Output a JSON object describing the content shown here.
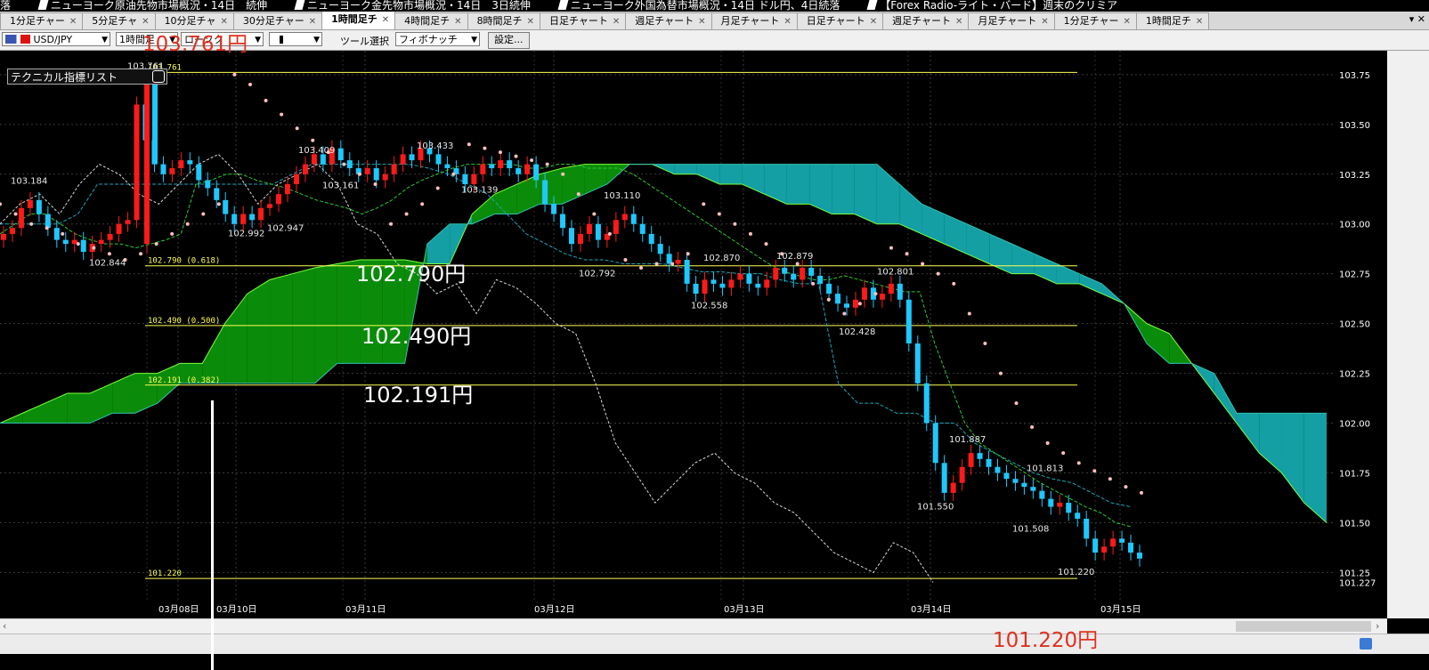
{
  "ticker": [
    "落",
    "ニューヨーク原油先物市場概況・14日　続伸",
    "ニューヨーク金先物市場概況・14日　3日続伸",
    "ニューヨーク外国為替市場概況・14日 ドル円、4日続落",
    "【Forex Radio-ライト・バード】週末のクリミア"
  ],
  "tabs": [
    {
      "label": "1分足チャー",
      "active": false
    },
    {
      "label": "5分足チャ",
      "active": false
    },
    {
      "label": "10分足チャ",
      "active": false
    },
    {
      "label": "30分足チャー",
      "active": false
    },
    {
      "label": "1時間足チ",
      "active": true
    },
    {
      "label": "4時間足チ",
      "active": false
    },
    {
      "label": "8時間足チ",
      "active": false
    },
    {
      "label": "日足チャート",
      "active": false
    },
    {
      "label": "週足チャート",
      "active": false
    },
    {
      "label": "月足チャート",
      "active": false
    },
    {
      "label": "日足チャート",
      "active": false
    },
    {
      "label": "週足チャート",
      "active": false
    },
    {
      "label": "月足チャート",
      "active": false
    },
    {
      "label": "1分足チャー",
      "active": false
    },
    {
      "label": "1時間足チ",
      "active": false
    }
  ],
  "tab_controls": "▾ ✕",
  "toolbar": {
    "pair": "USD/JPY",
    "timeframe": "1時間足",
    "chart_style": "ローソク",
    "tool_label": "ツール選択",
    "tool_value": "フィボナッチ",
    "settings": "設定..."
  },
  "tech_list_label": "テクニカル指標リスト",
  "annotations": {
    "high": "103.761円",
    "fib618": "102.790円",
    "fib500": "102.490円",
    "fib382": "102.191円",
    "low": "101.220円"
  },
  "colors": {
    "up": "#ff1a1a",
    "down": "#1ec8ff",
    "cloud_bull": "#0a8c0a",
    "cloud_bear": "#139fa3",
    "fib": "#ffff55",
    "psar": "#ffc0c0",
    "grid": "#3a3a3a"
  },
  "chart_data": {
    "type": "candlestick",
    "ylim": [
      101.1,
      103.87
    ],
    "y_ticks": [
      103.75,
      103.5,
      103.25,
      103.0,
      102.75,
      102.5,
      102.25,
      102.0,
      101.75,
      101.5,
      101.25
    ],
    "y_tick_labels": [
      "103.75",
      "103.50",
      "103.25",
      "103.00",
      "102.75",
      "102.50",
      "102.25",
      "102.00",
      "101.75",
      "101.50",
      "101.25"
    ],
    "y_edge_label": "101.227",
    "x_dates": [
      "03月08日",
      "03月10日",
      "03月11日",
      "03月12日",
      "03月13日",
      "03月14日",
      "03月15日"
    ],
    "fib_levels": [
      {
        "value": 103.761,
        "label": "103.761"
      },
      {
        "value": 102.79,
        "label": "102.790 (0.618)"
      },
      {
        "value": 102.49,
        "label": "102.490 (0.500)"
      },
      {
        "value": 102.191,
        "label": "102.191 (0.382)"
      },
      {
        "value": 101.22,
        "label": "101.220"
      }
    ],
    "price_labels": [
      {
        "v": 103.184,
        "t": "103.184"
      },
      {
        "v": 102.844,
        "t": "102.844"
      },
      {
        "v": 103.761,
        "t": "103.761"
      },
      {
        "v": 102.992,
        "t": "102.992"
      },
      {
        "v": 102.947,
        "t": "102.947"
      },
      {
        "v": 103.409,
        "t": "103.409"
      },
      {
        "v": 103.161,
        "t": "103.161"
      },
      {
        "v": 103.433,
        "t": "103.433"
      },
      {
        "v": 103.139,
        "t": "103.139"
      },
      {
        "v": 102.792,
        "t": "102.792"
      },
      {
        "v": 103.11,
        "t": "103.110"
      },
      {
        "v": 102.87,
        "t": "102.870"
      },
      {
        "v": 102.558,
        "t": "102.558"
      },
      {
        "v": 102.879,
        "t": "102.879"
      },
      {
        "v": 102.428,
        "t": "102.428"
      },
      {
        "v": 102.801,
        "t": "102.801"
      },
      {
        "v": 101.887,
        "t": "101.887"
      },
      {
        "v": 101.813,
        "t": "101.813"
      },
      {
        "v": 101.55,
        "t": "101.550"
      },
      {
        "v": 101.508,
        "t": "101.508"
      },
      {
        "v": 101.22,
        "t": "101.220"
      }
    ],
    "closes": [
      102.95,
      102.98,
      103.08,
      103.12,
      103.05,
      102.98,
      102.92,
      102.9,
      102.92,
      102.86,
      102.9,
      102.92,
      102.95,
      103.0,
      103.02,
      103.6,
      103.42,
      103.3,
      103.25,
      103.28,
      103.32,
      103.3,
      103.22,
      103.18,
      103.12,
      103.05,
      103.0,
      103.05,
      103.02,
      103.08,
      103.1,
      103.15,
      103.2,
      103.25,
      103.3,
      103.35,
      103.3,
      103.38,
      103.32,
      103.28,
      103.25,
      103.28,
      103.22,
      103.25,
      103.3,
      103.35,
      103.32,
      103.38,
      103.35,
      103.3,
      103.28,
      103.25,
      103.2,
      103.25,
      103.3,
      103.28,
      103.32,
      103.28,
      103.25,
      103.3,
      103.22,
      103.1,
      103.05,
      102.98,
      102.9,
      102.95,
      103.0,
      102.92,
      102.95,
      103.02,
      103.05,
      103.0,
      102.95,
      102.9,
      102.85,
      102.8,
      102.82,
      102.7,
      102.65,
      102.72,
      102.7,
      102.68,
      102.72,
      102.75,
      102.7,
      102.68,
      102.72,
      102.78,
      102.75,
      102.72,
      102.78,
      102.74,
      102.7,
      102.65,
      102.6,
      102.58,
      102.62,
      102.68,
      102.62,
      102.65,
      102.7,
      102.62,
      102.4,
      102.2,
      102.0,
      101.8,
      101.65,
      101.7,
      101.78,
      101.85,
      101.82,
      101.78,
      101.75,
      101.72,
      101.7,
      101.68,
      101.66,
      101.62,
      101.58,
      101.6,
      101.55,
      101.52,
      101.42,
      101.35,
      101.38,
      101.42,
      101.4,
      101.35,
      101.32
    ],
    "tenkan": [
      102.95,
      103.0,
      103.05,
      103.05,
      103.0,
      102.95,
      102.92,
      102.9,
      102.9,
      102.88,
      102.9,
      102.92,
      102.95,
      103.2,
      103.22,
      103.25,
      103.25,
      103.22,
      103.2,
      103.18,
      103.15,
      103.12,
      103.1,
      103.08,
      103.05,
      103.08,
      103.12,
      103.18,
      103.22,
      103.25,
      103.28,
      103.3,
      103.3,
      103.3,
      103.3,
      103.28,
      103.28,
      103.3,
      103.3,
      103.28,
      103.28,
      103.28,
      103.25,
      103.2,
      103.15,
      103.1,
      103.05,
      103.0,
      102.95,
      102.9,
      102.85,
      102.8,
      102.76,
      102.74,
      102.72,
      102.72,
      102.74,
      102.72,
      102.7,
      102.68,
      102.66,
      102.66,
      102.4,
      102.2,
      102.0,
      101.9,
      101.85,
      101.8,
      101.75,
      101.7,
      101.66,
      101.62,
      101.58,
      101.55,
      101.5,
      101.48
    ],
    "kijun": [
      103.0,
      103.0,
      103.0,
      103.0,
      103.05,
      103.2,
      103.2,
      103.2,
      103.2,
      103.2,
      103.2,
      103.2,
      103.2,
      103.2,
      103.2,
      103.25,
      103.3,
      103.3,
      103.3,
      103.3,
      103.3,
      103.3,
      103.28,
      103.25,
      103.2,
      103.15,
      103.05,
      102.95,
      102.9,
      102.85,
      102.82,
      102.82,
      102.8,
      102.8,
      102.8,
      102.78,
      102.76,
      102.76,
      102.75,
      102.75,
      102.72,
      102.7,
      102.7,
      102.2,
      102.1,
      102.1,
      102.05,
      102.05,
      102.0,
      102.0,
      101.9,
      101.85,
      101.8,
      101.75,
      101.72,
      101.7,
      101.65,
      101.6,
      101.58
    ],
    "chikou": [
      103.0,
      103.1,
      103.15,
      103.05,
      103.2,
      103.3,
      103.25,
      103.15,
      103.1,
      103.2,
      103.3,
      103.35,
      103.25,
      103.1,
      103.2,
      103.25,
      103.3,
      103.2,
      103.0,
      102.95,
      102.8,
      102.75,
      102.65,
      102.7,
      102.55,
      102.72,
      102.68,
      102.6,
      102.5,
      102.45,
      102.2,
      101.9,
      101.75,
      101.6,
      101.7,
      101.8,
      101.85,
      101.75,
      101.7,
      101.6,
      101.55,
      101.45,
      101.35,
      101.3,
      101.25,
      101.4,
      101.35,
      101.2
    ],
    "span_a": [
      102.0,
      102.05,
      102.1,
      102.15,
      102.15,
      102.2,
      102.25,
      102.25,
      102.3,
      102.3,
      102.5,
      102.65,
      102.72,
      102.75,
      102.78,
      102.8,
      102.82,
      102.82,
      102.82,
      102.8,
      102.8,
      103.05,
      103.15,
      103.2,
      103.25,
      103.28,
      103.3,
      103.3,
      103.3,
      103.3,
      103.25,
      103.25,
      103.2,
      103.2,
      103.15,
      103.1,
      103.1,
      103.05,
      103.05,
      103.0,
      103.0,
      102.95,
      102.9,
      102.85,
      102.8,
      102.75,
      102.75,
      102.7,
      102.7,
      102.65,
      102.6,
      102.5,
      102.45,
      102.3,
      102.15,
      102.0,
      101.85,
      101.75,
      101.6,
      101.5
    ],
    "span_b": [
      102.0,
      102.0,
      102.0,
      102.0,
      102.0,
      102.05,
      102.05,
      102.1,
      102.2,
      102.2,
      102.2,
      102.2,
      102.2,
      102.2,
      102.2,
      102.3,
      102.3,
      102.3,
      102.3,
      102.9,
      103.0,
      103.0,
      103.05,
      103.05,
      103.1,
      103.1,
      103.15,
      103.2,
      103.3,
      103.3,
      103.3,
      103.3,
      103.3,
      103.3,
      103.3,
      103.3,
      103.3,
      103.3,
      103.3,
      103.3,
      103.2,
      103.1,
      103.05,
      103.0,
      102.95,
      102.9,
      102.85,
      102.8,
      102.75,
      102.7,
      102.6,
      102.4,
      102.3,
      102.3,
      102.25,
      102.05,
      102.05,
      102.05,
      102.05,
      102.05
    ],
    "psar": [
      103.1,
      103.05,
      103.0,
      102.98,
      102.95,
      102.9,
      102.88,
      102.85,
      102.82,
      102.85,
      102.9,
      102.95,
      103.0,
      103.05,
      103.1,
      103.75,
      103.7,
      103.62,
      103.55,
      103.48,
      103.42,
      103.36,
      103.3,
      103.25,
      103.2,
      103.0,
      103.05,
      103.1,
      103.18,
      103.25,
      103.4,
      103.38,
      103.36,
      103.34,
      103.32,
      103.3,
      103.25,
      103.15,
      103.05,
      102.95,
      102.82,
      102.78,
      102.8,
      102.8,
      102.85,
      103.1,
      103.05,
      103.0,
      102.95,
      102.9,
      102.85,
      102.8,
      102.7,
      102.62,
      102.55,
      102.6,
      102.65,
      102.88,
      102.85,
      102.8,
      102.75,
      102.7,
      102.55,
      102.4,
      102.25,
      102.1,
      101.98,
      101.9,
      101.85,
      101.8,
      101.76,
      101.72,
      101.68,
      101.65
    ]
  }
}
